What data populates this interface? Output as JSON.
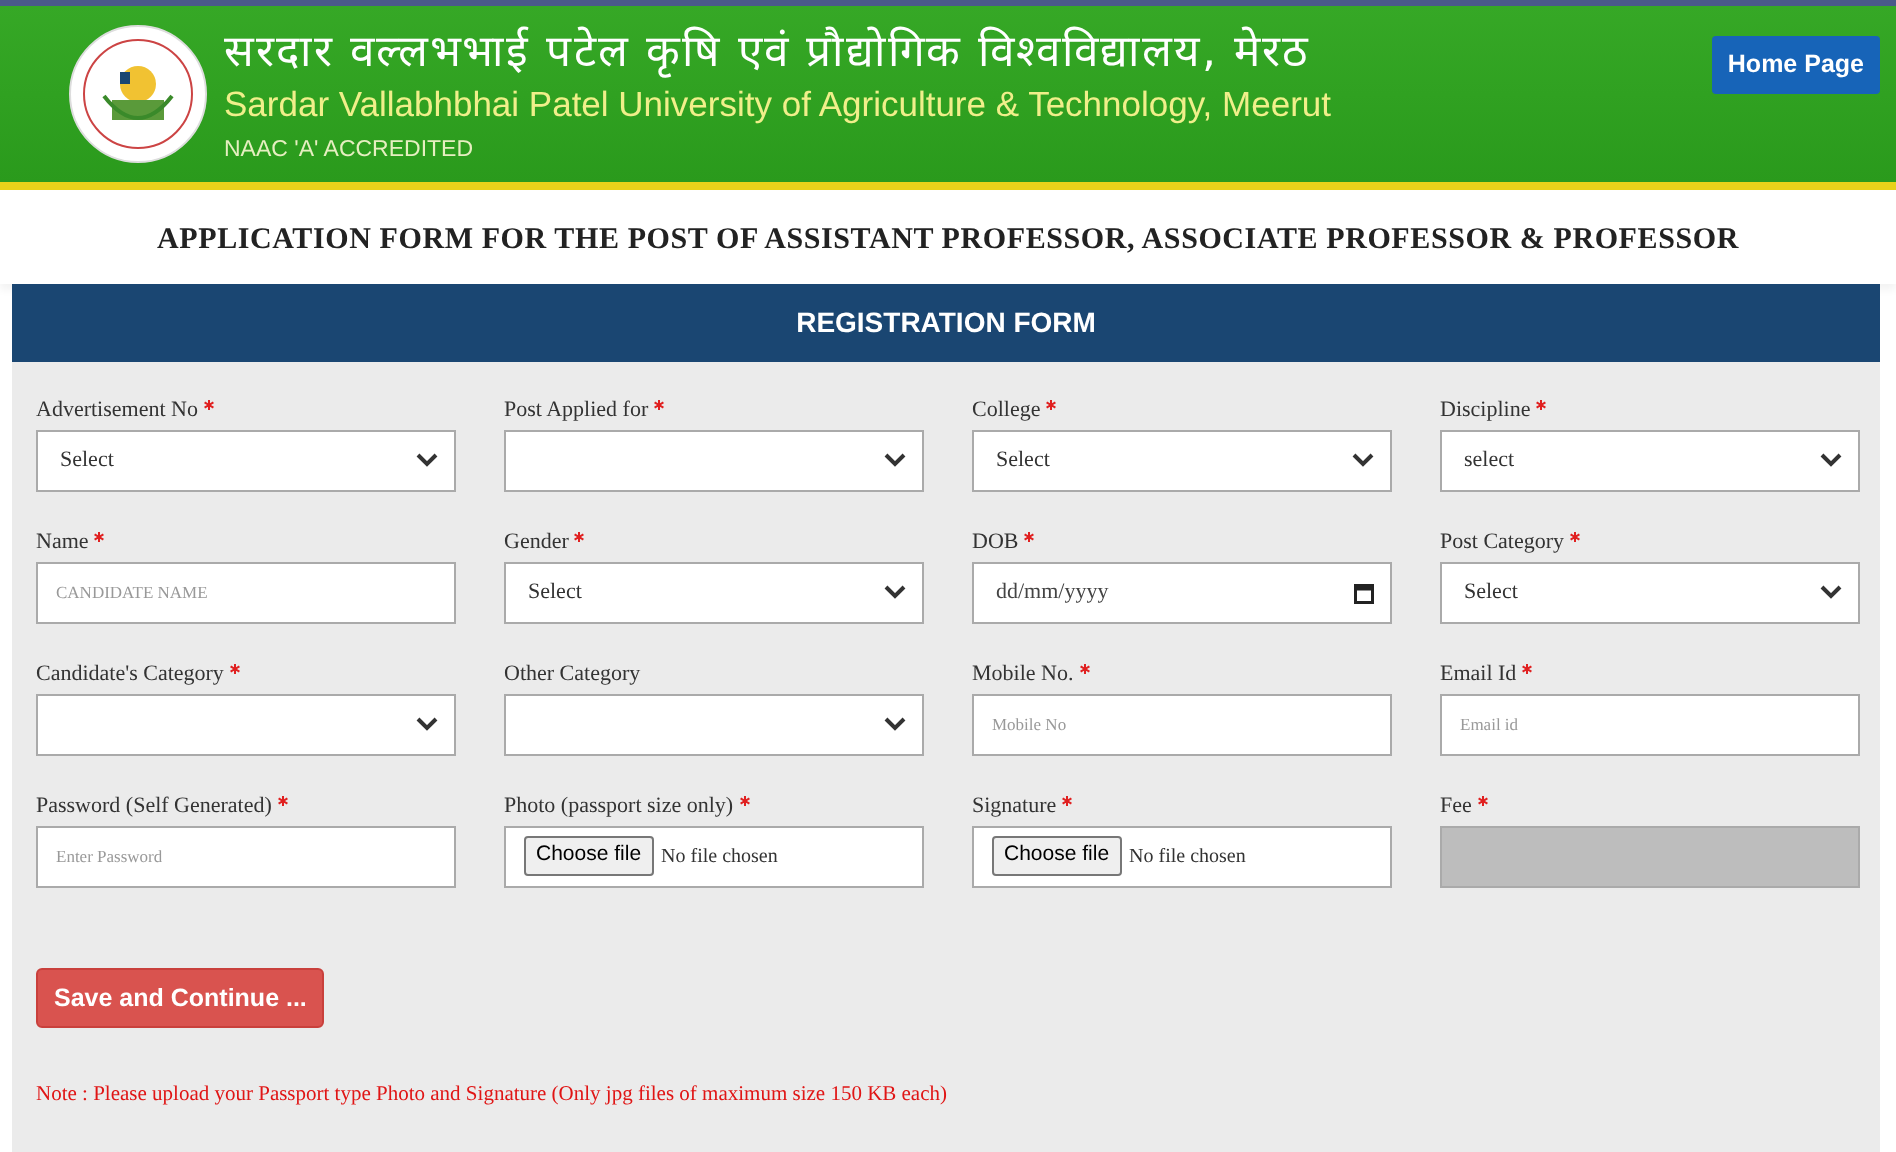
{
  "header": {
    "title_hindi": "सरदार वल्लभभाई पटेल कृषि एवं प्रौद्योगिक विश्वविद्यालय, मेरठ",
    "title_english": "Sardar Vallabhbhai Patel University of Agriculture & Technology, Meerut",
    "accreditation": "NAAC 'A' ACCREDITED",
    "home_button": "Home Page"
  },
  "page_title": "APPLICATION FORM FOR THE POST OF ASSISTANT PROFESSOR, ASSOCIATE PROFESSOR & PROFESSOR",
  "form": {
    "title": "REGISTRATION FORM",
    "fields": [
      {
        "label": "Advertisement No",
        "required": true,
        "kind": "select",
        "value": "Select"
      },
      {
        "label": "Post Applied for",
        "required": true,
        "kind": "select"
      },
      {
        "label": "College",
        "required": true,
        "kind": "select",
        "value": "Select"
      },
      {
        "label": "Discipline",
        "required": true,
        "kind": "select",
        "value": "select"
      },
      {
        "label": "Name",
        "required": true,
        "kind": "text",
        "placeholder": "CANDIDATE NAME"
      },
      {
        "label": "Gender",
        "required": true,
        "kind": "select",
        "value": "Select"
      },
      {
        "label": "DOB",
        "required": true,
        "kind": "date",
        "placeholder": "dd/mm/yyyy"
      },
      {
        "label": "Post Category",
        "required": true,
        "kind": "select",
        "value": "Select"
      },
      {
        "label": "Candidate's Category",
        "required": true,
        "kind": "select"
      },
      {
        "label": "Other Category",
        "required": false,
        "kind": "select"
      },
      {
        "label": "Mobile No.",
        "required": true,
        "kind": "text",
        "placeholder": "Mobile No"
      },
      {
        "label": "Email Id",
        "required": true,
        "kind": "text",
        "placeholder": "Email id"
      },
      {
        "label": "Password (Self Generated)",
        "required": true,
        "kind": "text",
        "placeholder": "Enter Password"
      },
      {
        "label": "Photo (passport size only)",
        "required": true,
        "kind": "file",
        "button": "Choose file",
        "status": "No file chosen"
      },
      {
        "label": "Signature",
        "required": true,
        "kind": "file",
        "button": "Choose file",
        "status": "No file chosen"
      },
      {
        "label": "Fee",
        "required": true,
        "kind": "readonly"
      }
    ],
    "submit": "Save and Continue ...",
    "note": "Note : Please upload your Passport type Photo and Signature (Only jpg files of maximum size 150 KB each)"
  }
}
